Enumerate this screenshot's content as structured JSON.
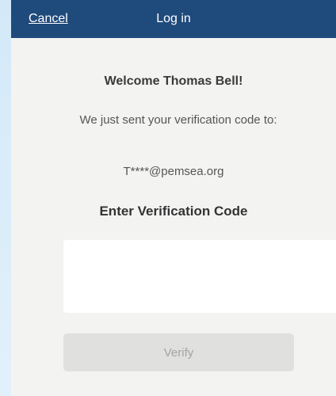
{
  "nav": {
    "cancel_label": "Cancel",
    "title": "Log in"
  },
  "content": {
    "welcome": "Welcome Thomas Bell!",
    "sent_message": "We just sent your verification code to:",
    "masked_email": "T****@pemsea.org",
    "code_heading": "Enter Verification Code",
    "code_digits": [
      "",
      "",
      "",
      ""
    ],
    "verify_label": "Verify"
  },
  "colors": {
    "nav_background": "#1f4a7c",
    "page_background": "#f3f3f2",
    "verify_button_disabled": "#e0e0df",
    "backdrop": "#d6ebfa"
  }
}
